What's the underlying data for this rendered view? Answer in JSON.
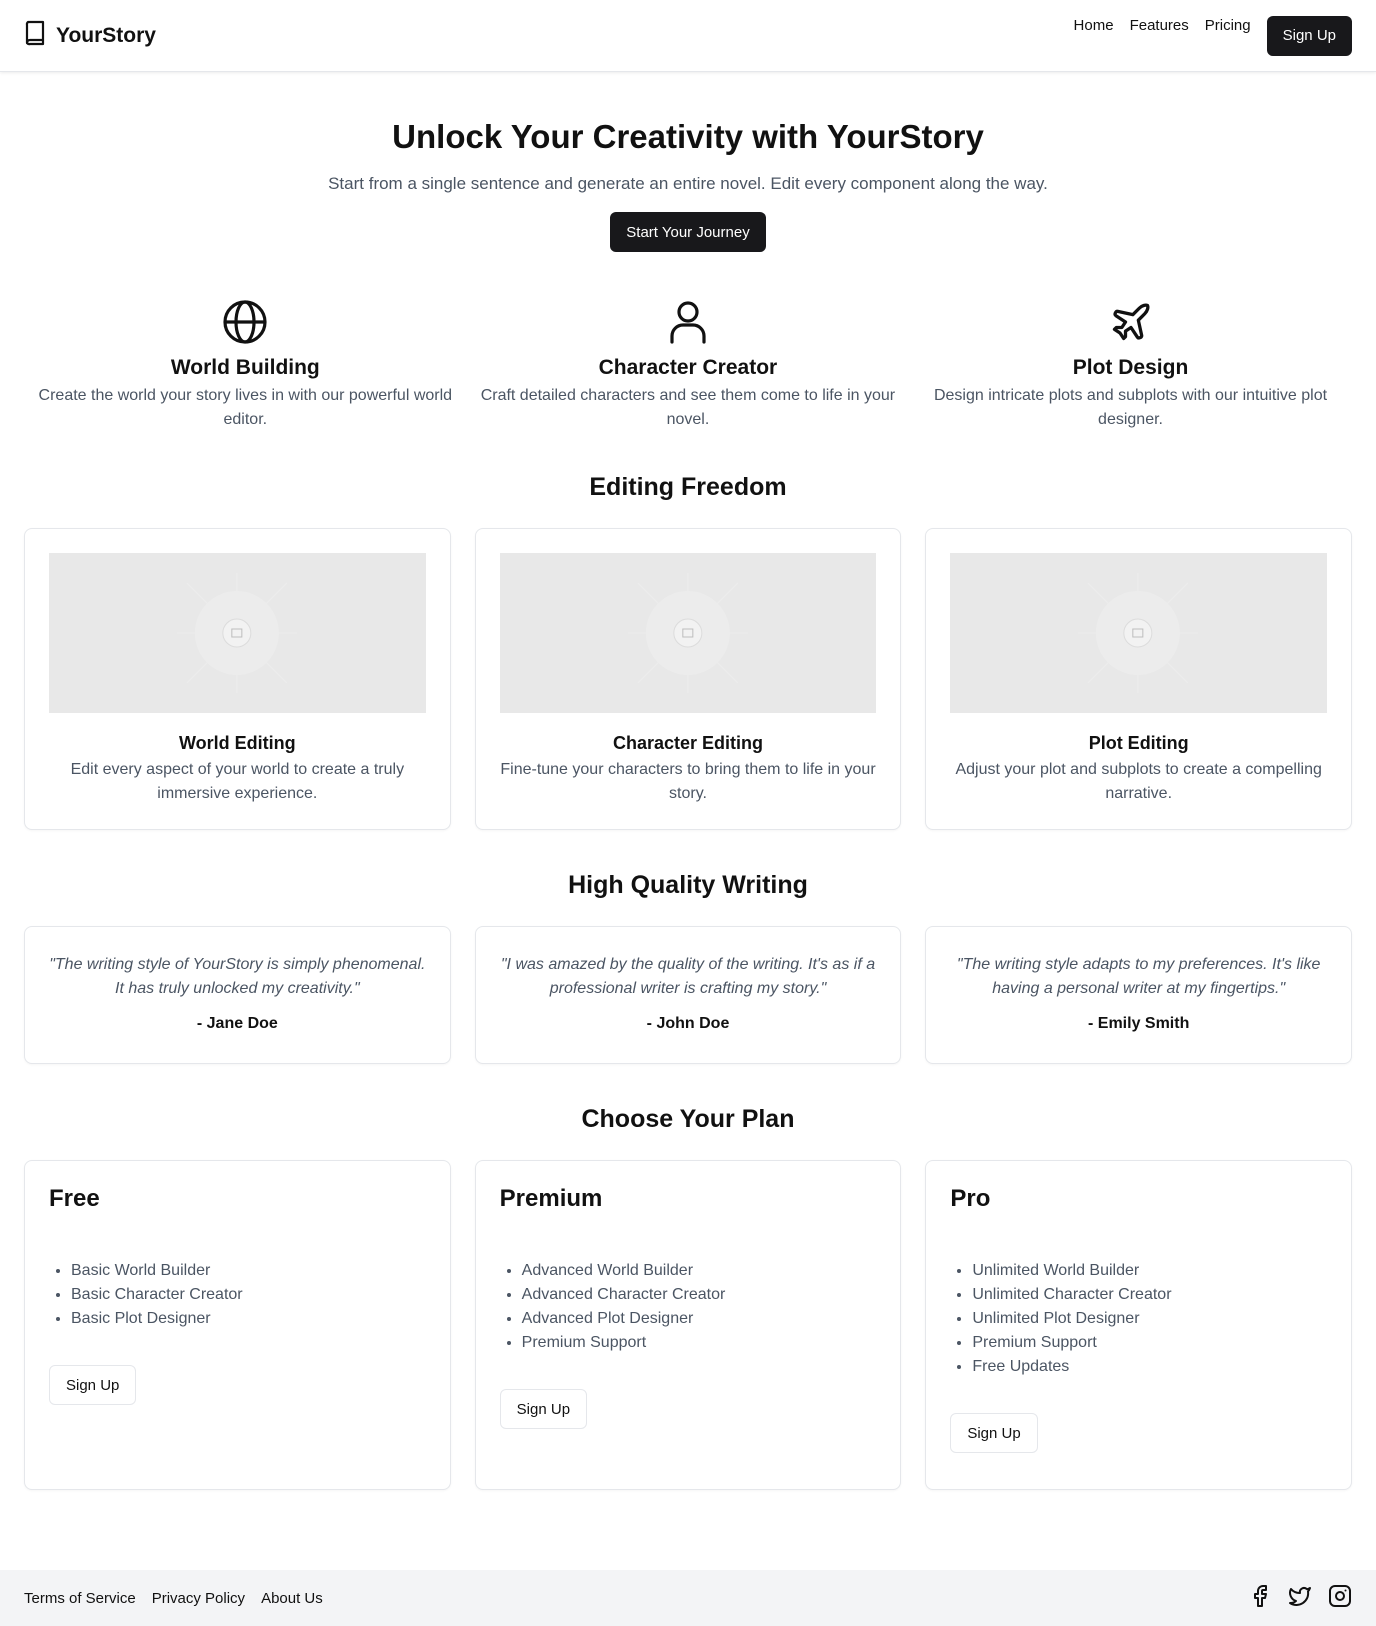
{
  "header": {
    "brand": "YourStory",
    "nav": [
      "Home",
      "Features",
      "Pricing"
    ],
    "signup_label": "Sign Up"
  },
  "hero": {
    "title": "Unlock Your Creativity with YourStory",
    "subtitle": "Start from a single sentence and generate an entire novel. Edit every component along the way.",
    "cta_label": "Start Your Journey"
  },
  "features": [
    {
      "icon": "globe-icon",
      "title": "World Building",
      "desc": "Create the world your story lives in with our powerful world editor."
    },
    {
      "icon": "user-icon",
      "title": "Character Creator",
      "desc": "Craft detailed characters and see them come to life in your novel."
    },
    {
      "icon": "plane-icon",
      "title": "Plot Design",
      "desc": "Design intricate plots and subplots with our intuitive plot designer."
    }
  ],
  "editing": {
    "title": "Editing Freedom",
    "cards": [
      {
        "title": "World Editing",
        "desc": "Edit every aspect of your world to create a truly immersive experience."
      },
      {
        "title": "Character Editing",
        "desc": "Fine-tune your characters to bring them to life in your story."
      },
      {
        "title": "Plot Editing",
        "desc": "Adjust your plot and subplots to create a compelling narrative."
      }
    ]
  },
  "quality": {
    "title": "High Quality Writing",
    "testimonials": [
      {
        "quote": "\"The writing style of YourStory is simply phenomenal. It has truly unlocked my creativity.\"",
        "author": "- Jane Doe"
      },
      {
        "quote": "\"I was amazed by the quality of the writing. It's as if a professional writer is crafting my story.\"",
        "author": "- John Doe"
      },
      {
        "quote": "\"The writing style adapts to my preferences. It's like having a personal writer at my fingertips.\"",
        "author": "- Emily Smith"
      }
    ]
  },
  "pricing": {
    "title": "Choose Your Plan",
    "plans": [
      {
        "name": "Free",
        "features": [
          "Basic World Builder",
          "Basic Character Creator",
          "Basic Plot Designer"
        ],
        "cta": "Sign Up"
      },
      {
        "name": "Premium",
        "features": [
          "Advanced World Builder",
          "Advanced Character Creator",
          "Advanced Plot Designer",
          "Premium Support"
        ],
        "cta": "Sign Up"
      },
      {
        "name": "Pro",
        "features": [
          "Unlimited World Builder",
          "Unlimited Character Creator",
          "Unlimited Plot Designer",
          "Premium Support",
          "Free Updates"
        ],
        "cta": "Sign Up"
      }
    ]
  },
  "footer": {
    "links": [
      "Terms of Service",
      "Privacy Policy",
      "About Us"
    ],
    "social": [
      "facebook-icon",
      "twitter-icon",
      "instagram-icon"
    ]
  },
  "colors": {
    "primary": "#18181b",
    "muted_text": "#4b5563",
    "border": "#e5e7eb",
    "footer_bg": "#f3f4f6",
    "placeholder": "#e8e8e8"
  }
}
